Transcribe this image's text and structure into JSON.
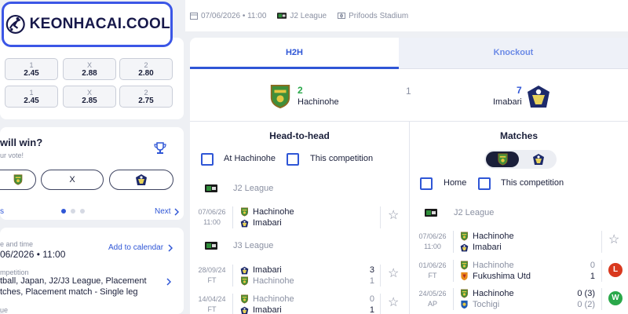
{
  "logo": {
    "text": "KEONHACAI.COOL"
  },
  "header": {
    "datetime": "07/06/2026 • 11:00",
    "league": "J2 League",
    "stadium": "Prifoods Stadium"
  },
  "odds": {
    "rows": [
      [
        {
          "label": "1",
          "value": "2.45"
        },
        {
          "label": "X",
          "value": "2.88"
        },
        {
          "label": "2",
          "value": "2.80"
        }
      ],
      [
        {
          "label": "1",
          "value": "2.45"
        },
        {
          "label": "X",
          "value": "2.85"
        },
        {
          "label": "2",
          "value": "2.75"
        }
      ]
    ]
  },
  "vote": {
    "title": "will win?",
    "subtitle": "ur vote!",
    "draw_label": "X",
    "prev_label": "s",
    "next_label": "Next",
    "active_page": 1,
    "pages": 3
  },
  "date_info": {
    "heading": "e and time",
    "date": "06/2026 • 11:00",
    "add_to_calendar": "Add to calendar",
    "competition_heading": "mpetition",
    "competition_line1": "tball, Japan, J2/J3 League, Placement",
    "competition_line2": "tches, Placement match - Single leg",
    "venue_heading": "ue"
  },
  "tabs": {
    "h2h": "H2H",
    "knockout": "Knockout"
  },
  "summary": {
    "home_wins": "2",
    "home_name": "Hachinohe",
    "draws": "1",
    "away_wins": "7",
    "away_name": "Imabari"
  },
  "h2h": {
    "title": "Head-to-head",
    "filter_home": "At Hachinohe",
    "filter_comp": "This competition",
    "groups": [
      {
        "league": "J2 League",
        "matches": [
          {
            "date": "07/06/26",
            "status": "11:00",
            "home": "Hachinohe",
            "away": "Imabari",
            "home_score": "",
            "away_score": "",
            "dim_home": false,
            "dim_away": false
          }
        ]
      },
      {
        "league": "J3 League",
        "matches": [
          {
            "date": "28/09/24",
            "status": "FT",
            "home": "Imabari",
            "away": "Hachinohe",
            "home_score": "3",
            "away_score": "1",
            "dim_home": false,
            "dim_away": true
          },
          {
            "date": "14/04/24",
            "status": "FT",
            "home": "Hachinohe",
            "away": "Imabari",
            "home_score": "0",
            "away_score": "1",
            "dim_home": true,
            "dim_away": false
          }
        ]
      }
    ]
  },
  "matches": {
    "title": "Matches",
    "filter_home": "Home",
    "filter_comp": "This competition",
    "league": "J2 League",
    "rows": [
      {
        "date": "07/06/26",
        "status": "11:00",
        "home": "Hachinohe",
        "away": "Imabari",
        "home_score": "",
        "away_score": "",
        "result": ""
      },
      {
        "date": "01/06/26",
        "status": "FT",
        "home": "Hachinohe",
        "away": "Fukushima Utd",
        "home_score": "0",
        "away_score": "1",
        "result": "L"
      },
      {
        "date": "24/05/26",
        "status": "AP",
        "home": "Hachinohe",
        "away": "Tochigi",
        "home_score": "0 (3)",
        "away_score": "0 (2)",
        "result": "W"
      }
    ]
  },
  "colors": {
    "accent": "#2f56d6",
    "win": "#2aa84a",
    "loss": "#d9381e",
    "hachinohe": "#3f8f3a",
    "imabari": "#1d2a6b"
  }
}
